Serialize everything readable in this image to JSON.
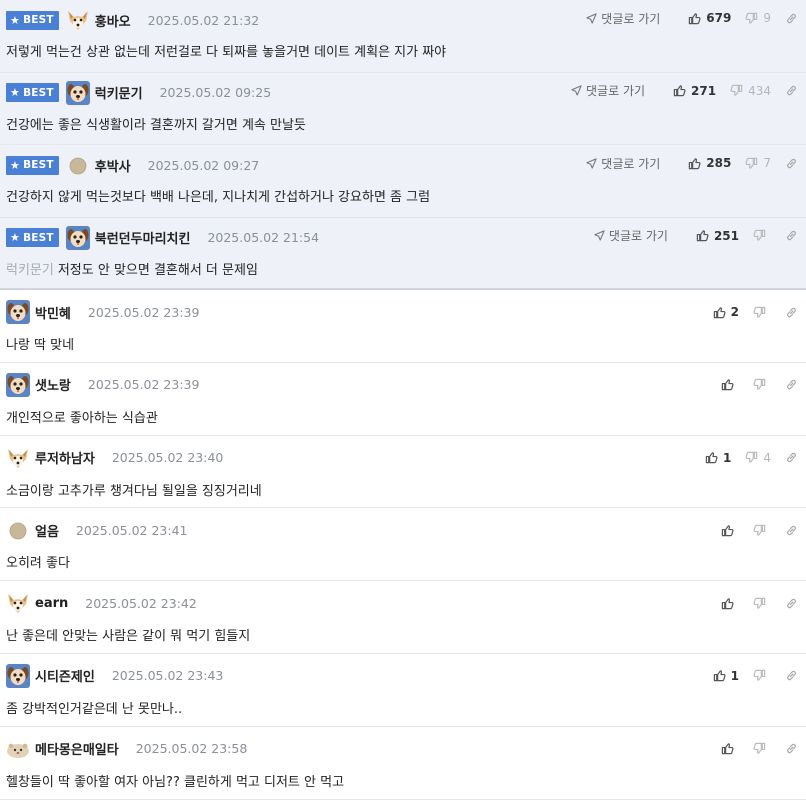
{
  "labels": {
    "best": "BEST",
    "goto_reply": "댓글로 가기"
  },
  "colors": {
    "best_bg": "#eef1f8",
    "badge": "#4a7fd6"
  },
  "best_comments": [
    {
      "avatar": "fox-avatar",
      "nickname": "훙바오",
      "date": "2025.05.02 21:32",
      "text": "저렇게 먹는건 상관 없는데 저런걸로 다 퇴짜를 놓을거면 데이트 계획은 지가 짜야",
      "upvotes": "679",
      "downvotes": "9"
    },
    {
      "avatar": "dog-avatar",
      "nickname": "럭키문기",
      "date": "2025.05.02 09:25",
      "text": "건강에는 좋은 식생활이라 결혼까지 갈거면 계속 만날듯",
      "upvotes": "271",
      "downvotes": "434"
    },
    {
      "avatar": "dot-avatar",
      "nickname": "후박사",
      "date": "2025.05.02 09:27",
      "text": "건강하지 않게 먹는것보다 백배 나은데, 지나치게 간섭하거나 강요하면 좀 그럼",
      "upvotes": "285",
      "downvotes": "7"
    },
    {
      "avatar": "dog-avatar",
      "nickname": "북런던두마리치킨",
      "date": "2025.05.02 21:54",
      "reply_to": "럭키문기",
      "text": "저정도 안 맞으면 결혼해서 더 문제임",
      "upvotes": "251",
      "downvotes": ""
    }
  ],
  "comments": [
    {
      "avatar": "dog-avatar",
      "nickname": "박민혜",
      "date": "2025.05.02 23:39",
      "text": "나랑 딱 맞네",
      "upvotes": "2",
      "downvotes": ""
    },
    {
      "avatar": "dog-avatar",
      "nickname": "샛노랑",
      "date": "2025.05.02 23:39",
      "text": "개인적으로 좋아하는 식습관",
      "upvotes": "",
      "downvotes": ""
    },
    {
      "avatar": "fox-avatar",
      "nickname": "루저하남자",
      "date": "2025.05.02 23:40",
      "text": "소금이랑 고추가루 챙겨다님 될일을 징징거리네",
      "upvotes": "1",
      "downvotes": "4"
    },
    {
      "avatar": "dot-avatar",
      "nickname": "얼음",
      "date": "2025.05.02 23:41",
      "text": "오히려 좋다",
      "upvotes": "",
      "downvotes": ""
    },
    {
      "avatar": "fox-avatar",
      "nickname": "earn",
      "date": "2025.05.02 23:42",
      "text": "난 좋은데 안맞는 사람은 같이 뭐 먹기 힘들지",
      "upvotes": "",
      "downvotes": ""
    },
    {
      "avatar": "dog-avatar",
      "nickname": "시티즌제인",
      "date": "2025.05.02 23:43",
      "text": "좀 강박적인거같은데 난 못만나..",
      "upvotes": "1",
      "downvotes": ""
    },
    {
      "avatar": "hamster-avatar",
      "nickname": "메타몽은매일타",
      "date": "2025.05.02 23:58",
      "text": "헬창들이 딱 좋아할 여자 아님?? 클린하게 먹고 디저트 안 먹고",
      "upvotes": "",
      "downvotes": ""
    }
  ]
}
